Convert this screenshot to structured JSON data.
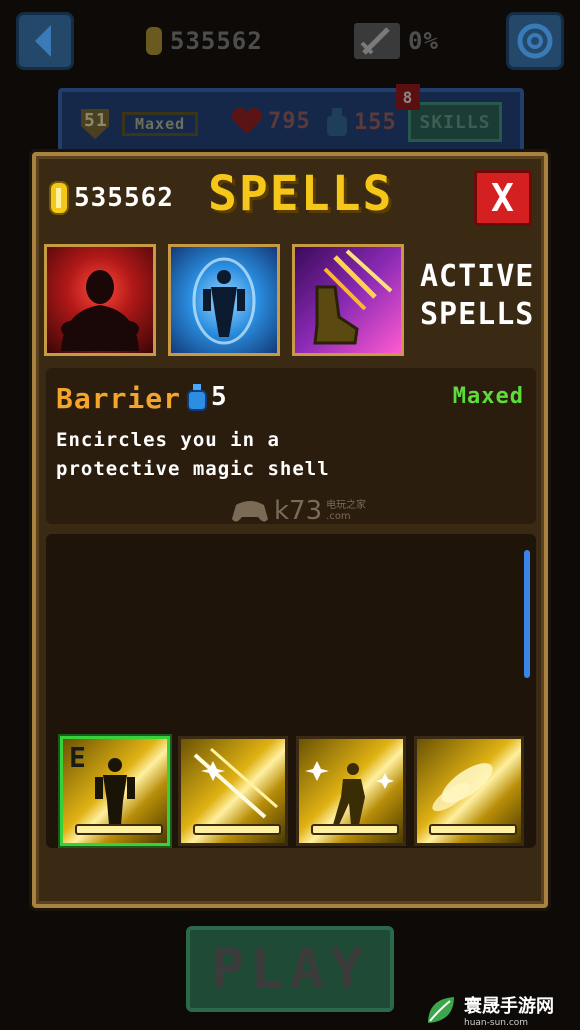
{
  "topbar": {
    "coins": "535562",
    "progress": "0%"
  },
  "stats_panel": {
    "level": "51",
    "level_status": "Maxed",
    "health": "795",
    "mana": "155",
    "skills_label": "SKILLS",
    "skills_badge": "8"
  },
  "dialog": {
    "coins": "535562",
    "title": "SPELLS",
    "close_label": "X",
    "active_label_line1": "ACTIVE",
    "active_label_line2": "SPELLS"
  },
  "spell_info": {
    "name": "Barrier",
    "cost": "5",
    "status": "Maxed",
    "description": "Encircles you in a protective magic shell"
  },
  "watermark": {
    "site": "k73",
    "site_sub": "电玩之家",
    "site_dom": ".com",
    "brand": "寰晟手游网",
    "brand_url": "huan-sun.com"
  },
  "skills": [
    {
      "badge": "E",
      "equipped": true
    },
    {
      "badge": "",
      "equipped": false
    },
    {
      "badge": "",
      "equipped": false
    },
    {
      "badge": "",
      "equipped": false
    }
  ],
  "play_label": "PLAY",
  "colors": {
    "gold": "#f5c718",
    "dialog_border": "#a8823e",
    "close": "#d42020",
    "status_green": "#5ddc3c",
    "spell_name": "#f5a52a",
    "scroll": "#3a86e8"
  },
  "icons": [
    "back-arrow-icon",
    "gold-coin-icon",
    "sword-icon",
    "gear-icon",
    "shield-icon",
    "heart-icon",
    "potion-icon"
  ]
}
